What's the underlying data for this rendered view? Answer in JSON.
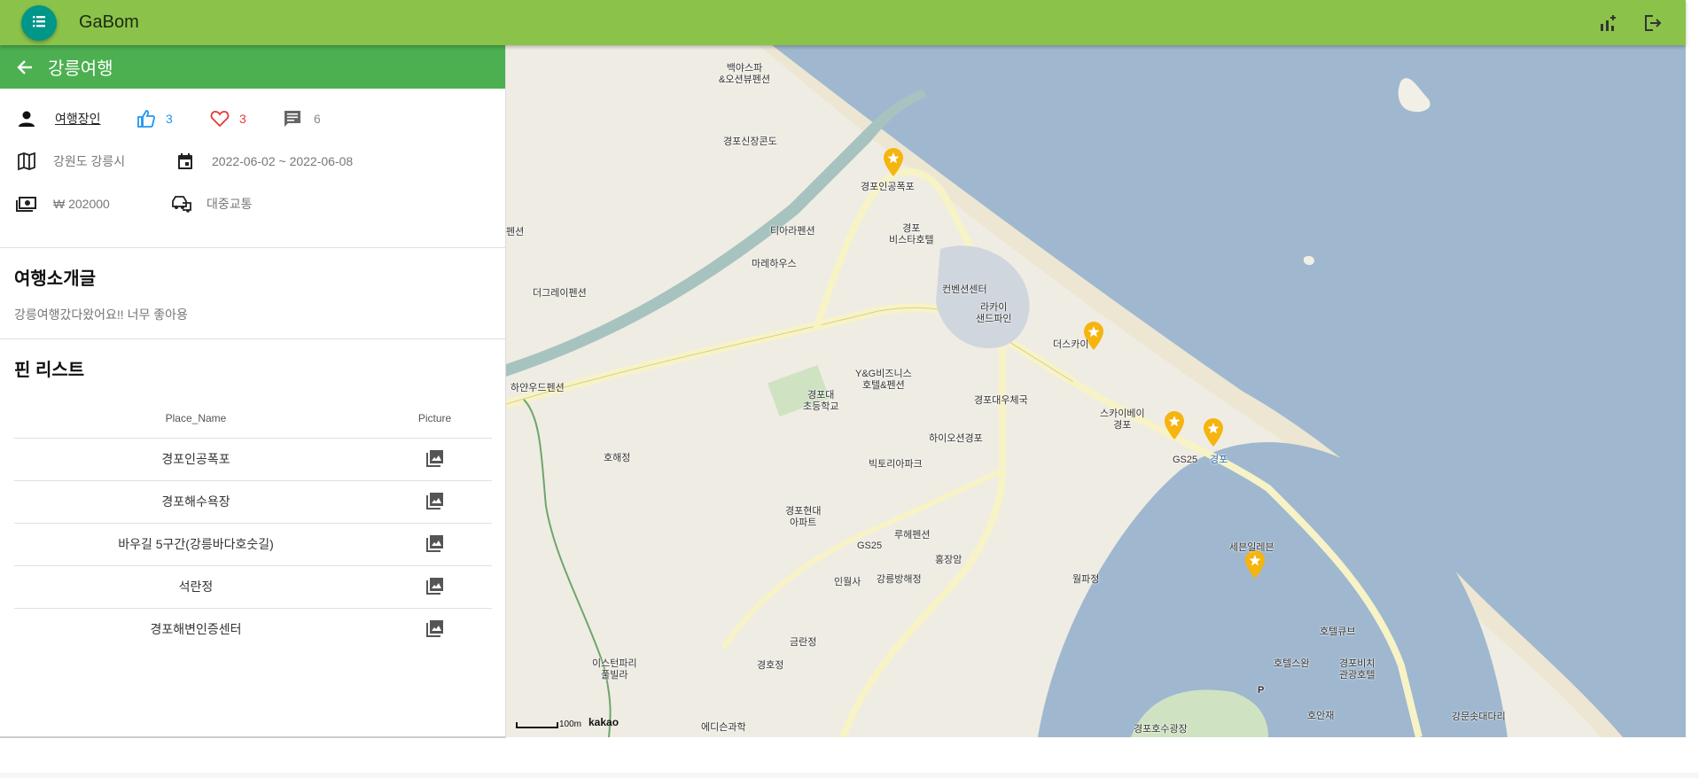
{
  "appbar": {
    "title": "GaBom",
    "menu_icon": "list-icon",
    "right_icons": [
      "chart-icon",
      "logout-icon"
    ],
    "colors": {
      "bar": "#8bc34a",
      "menu_button": "#009688"
    }
  },
  "panel": {
    "title": "강릉여행",
    "header_color": "#4caf50",
    "author": "여행장인",
    "likes": "3",
    "hearts": "3",
    "comments": "6",
    "region": "강원도 강릉시",
    "dates": "2022-06-02 ~ 2022-06-08",
    "cost": "₩ 202000",
    "transport": "대중교통",
    "intro_title": "여행소개글",
    "intro_text": "강릉여행갔다왔어요!! 너무 좋아용",
    "pins_title": "핀 리스트",
    "columns": [
      "Place_Name",
      "Picture"
    ],
    "pins": [
      "경포인공폭포",
      "경포해수욕장",
      "바우길 5구간(강릉바다호숫길)",
      "석란정",
      "경포해변인증센터"
    ]
  },
  "map": {
    "attribution": "kakao",
    "scale": "100m",
    "labels": {
      "l1": "백야스파\n&오션뷰펜션",
      "l2": "경포신장콘도",
      "l3": "경포인공폭포",
      "l4": "경포\n비스타호텔",
      "l5": "티아라펜션",
      "l6": "마레하우스",
      "l7": "더그레이펜션",
      "l8": "펜션",
      "l9": "컨벤션센터",
      "l10": "라카이\n샌드파인",
      "l11": "더스카이",
      "l12": "Y&G비즈니스\n호텔&펜션",
      "l13": "경포대\n초등학교",
      "l14": "경포대우체국",
      "l15": "하이오션경포",
      "l16": "스카이베이\n경포",
      "l17": "GS25",
      "l18": "경포",
      "l19": "하얀우드펜션",
      "l20": "호해정",
      "l21": "빅토리아파크",
      "l22": "경포현대\n아파트",
      "l23": "루헤펜션",
      "l24": "GS25",
      "l25": "인월사",
      "l26": "강릉방해정",
      "l27": "홍장암",
      "l28": "월파정",
      "l29": "세븐일레븐",
      "l30": "호텔큐브",
      "l31": "호텔스완",
      "l32": "경포비치\n관광호텔",
      "l33": "호안재",
      "l34": "강문솟대다리",
      "l35": "금란정",
      "l36": "경호정",
      "l37": "이스턴파리\n풀빌라",
      "l38": "에디슨과학",
      "l39": "경포호수광장",
      "l40": "P"
    },
    "marker_color": "#f6b40e",
    "sea_color": "#9fb8cf"
  }
}
